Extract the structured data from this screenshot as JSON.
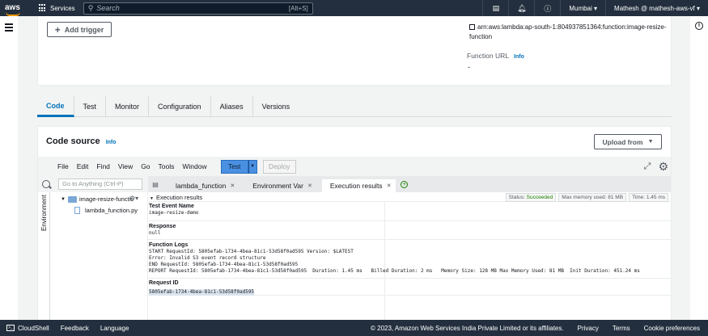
{
  "topnav": {
    "logo": "aws",
    "services": "Services",
    "search_placeholder": "Search",
    "search_shortcut": "[Alt+S]",
    "region": "Mumbai",
    "account": "Mathesh @ mathesh-aws-vf",
    "icons": [
      "cloudshell-icon",
      "bell-icon",
      "help-icon"
    ]
  },
  "top_panel": {
    "add_trigger": "Add trigger",
    "arn": "arn:aws:lambda:ap-south-1:804937851364:function:image-resize-function",
    "function_url_label": "Function URL",
    "info": "Info",
    "function_url_value": "-"
  },
  "tabs": [
    {
      "label": "Code",
      "active": true
    },
    {
      "label": "Test"
    },
    {
      "label": "Monitor"
    },
    {
      "label": "Configuration"
    },
    {
      "label": "Aliases"
    },
    {
      "label": "Versions"
    }
  ],
  "code_source": {
    "title": "Code source",
    "info": "Info",
    "upload_from": "Upload from"
  },
  "ide": {
    "menu": [
      "File",
      "Edit",
      "Find",
      "View",
      "Go",
      "Tools",
      "Window"
    ],
    "test_button": "Test",
    "deploy_button": "Deploy",
    "goto_placeholder": "Go to Anything (Ctrl-P)",
    "environment_label": "Environment",
    "folder": "image-resize-functic",
    "file": "lambda_function.py",
    "file_tabs": [
      {
        "label": "lambda_function",
        "active": false
      },
      {
        "label": "Environment Var",
        "active": false
      },
      {
        "label": "Execution results",
        "active": true
      }
    ]
  },
  "results": {
    "header": "Execution results",
    "status_label": "Status:",
    "status_value": "Succeeded",
    "memory": "Max memory used: 81 MB",
    "time": "Time: 1.45 ms",
    "test_event_label": "Test Event Name",
    "test_event_value": "image-resize-demo",
    "response_label": "Response",
    "response_value": "null",
    "logs_label": "Function Logs",
    "logs": [
      "START RequestId: 5805efab-1734-4bea-81c1-53d58f0ad595 Version: $LATEST",
      "Error: Invalid S3 event record structure",
      "END RequestId: 5805efab-1734-4bea-81c1-53d58f0ad595",
      "REPORT RequestId: 5805efab-1734-4bea-81c1-53d58f0ad595  Duration: 1.45 ms   Billed Duration: 2 ms   Memory Size: 128 MB Max Memory Used: 81 MB  Init Duration: 451.24 ms"
    ],
    "request_id_label": "Request ID",
    "request_id_value": "5805efab-1734-4bea-81c1-53d58f0ad595"
  },
  "footer": {
    "cloudshell": "CloudShell",
    "feedback": "Feedback",
    "language": "Language",
    "copyright": "© 2023, Amazon Web Services India Private Limited or its affiliates.",
    "privacy": "Privacy",
    "terms": "Terms",
    "cookies": "Cookie preferences"
  },
  "colors": {
    "nav_bg": "#232f3e",
    "accent": "#0073bb",
    "aws_orange": "#ff9900",
    "success": "#1d8102",
    "test_button": "#4a90e2"
  }
}
